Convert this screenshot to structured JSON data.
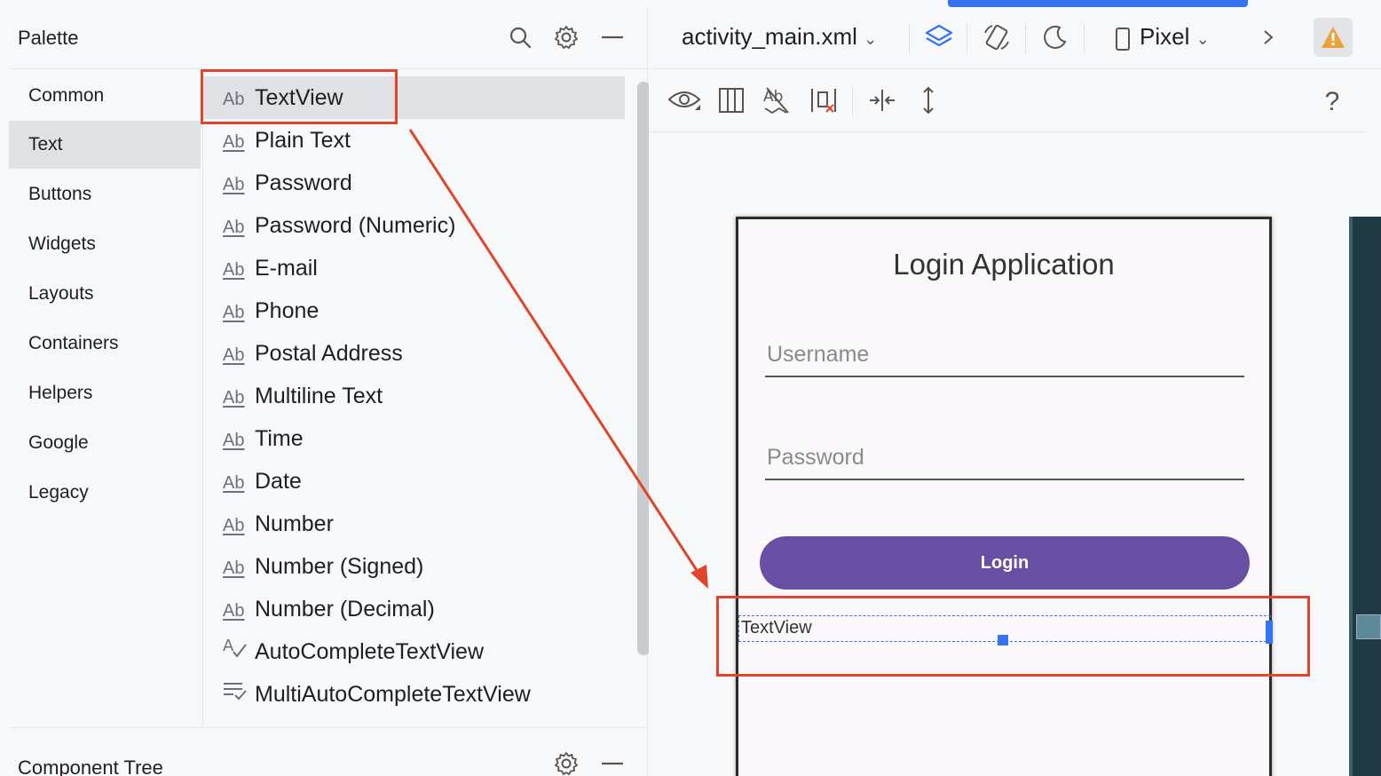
{
  "palette": {
    "title": "Palette",
    "categories": [
      "Common",
      "Text",
      "Buttons",
      "Widgets",
      "Layouts",
      "Containers",
      "Helpers",
      "Google",
      "Legacy"
    ],
    "selected_category": "Text",
    "items": [
      {
        "icon": "Ab",
        "label": "TextView"
      },
      {
        "icon": "Ab",
        "label": "Plain Text"
      },
      {
        "icon": "Ab",
        "label": "Password"
      },
      {
        "icon": "Ab",
        "label": "Password (Numeric)"
      },
      {
        "icon": "Ab",
        "label": "E-mail"
      },
      {
        "icon": "Ab",
        "label": "Phone"
      },
      {
        "icon": "Ab",
        "label": "Postal Address"
      },
      {
        "icon": "Ab",
        "label": "Multiline Text"
      },
      {
        "icon": "Ab",
        "label": "Time"
      },
      {
        "icon": "Ab",
        "label": "Date"
      },
      {
        "icon": "Ab",
        "label": "Number"
      },
      {
        "icon": "Ab",
        "label": "Number (Signed)"
      },
      {
        "icon": "Ab",
        "label": "Number (Decimal)"
      },
      {
        "icon": "autocomplete-icon",
        "label": "AutoCompleteTextView"
      },
      {
        "icon": "multiautocomplete-icon",
        "label": "MultiAutoCompleteTextView"
      }
    ]
  },
  "component_tree": {
    "title": "Component Tree"
  },
  "editor": {
    "file_name": "activity_main.xml",
    "device": "Pixel",
    "help": "?"
  },
  "preview": {
    "title": "Login Application",
    "username_placeholder": "Username",
    "password_placeholder": "Password",
    "login_label": "Login",
    "dropped_textview": "TextView"
  },
  "colors": {
    "accent": "#3574f0",
    "button": "#6750a4",
    "annotation": "#e0452b",
    "warning": "#e8a33a"
  }
}
